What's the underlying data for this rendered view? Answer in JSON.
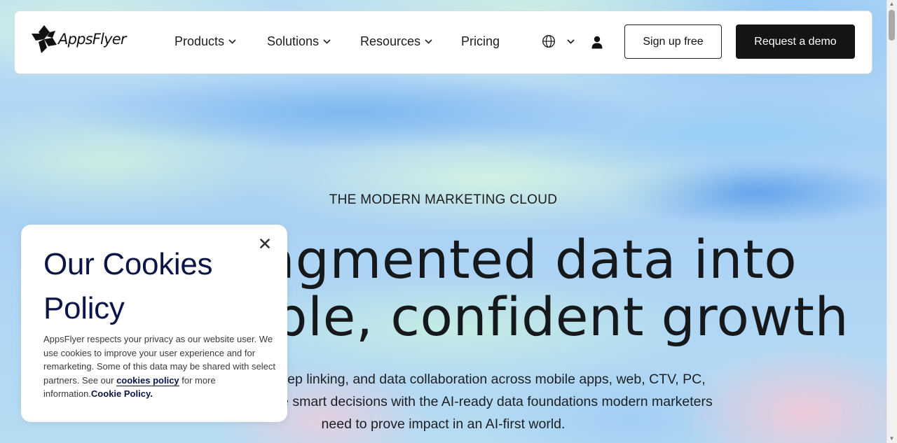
{
  "navbar": {
    "brand": "AppsFlyer",
    "items": [
      {
        "label": "Products",
        "has_dropdown": true
      },
      {
        "label": "Solutions",
        "has_dropdown": true
      },
      {
        "label": "Resources",
        "has_dropdown": true
      },
      {
        "label": "Pricing",
        "has_dropdown": false
      }
    ],
    "language_icon": "globe-icon",
    "account_icon": "user-icon",
    "signup_label": "Sign up free",
    "demo_label": "Request a demo"
  },
  "hero": {
    "eyebrow": "THE MODERN MARKETING CLOUD",
    "headline_line1": "Turn fragmented data into",
    "headline_line2": "measurable, confident growth",
    "sub_line1": "Measurement, deep linking, and data collaboration across mobile apps, web, CTV, PC,",
    "sub_line2": "and console. Make smart decisions with the AI-ready data foundations modern marketers",
    "sub_line3": "need to prove impact in an AI-first world."
  },
  "cookie_popup": {
    "title": "Our Cookies Policy",
    "body_text": "AppsFlyer respects your privacy as our website user. We use cookies to improve your user experience and for remarketing. Some of this data may be shared with select partners. See our ",
    "policy_link": "cookies policy",
    "body_tail": " for more information.",
    "policy_bold": "Cookie Policy."
  },
  "colors": {
    "brand_dark": "#141414",
    "cookie_title": "#0b1547"
  }
}
